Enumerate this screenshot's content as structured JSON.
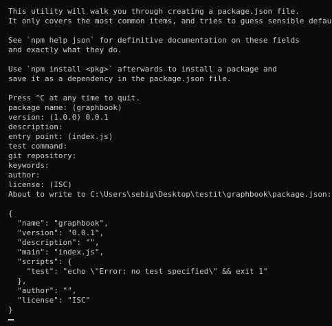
{
  "terminal": {
    "lines": [
      "This utility will walk you through creating a package.json file.",
      "It only covers the most common items, and tries to guess sensible defaults.",
      "",
      "See `npm help json` for definitive documentation on these fields",
      "and exactly what they do.",
      "",
      "Use `npm install <pkg>` afterwards to install a package and",
      "save it as a dependency in the package.json file.",
      "",
      "Press ^C at any time to quit.",
      "package name: (graphbook)",
      "version: (1.0.0) 0.0.1",
      "description:",
      "entry point: (index.js)",
      "test command:",
      "git repository:",
      "keywords:",
      "author:",
      "license: (ISC)",
      "About to write to C:\\Users\\sebig\\Desktop\\testit\\graphbook\\package.json:",
      "",
      "{",
      "  \"name\": \"graphbook\",",
      "  \"version\": \"0.0.1\",",
      "  \"description\": \"\",",
      "  \"main\": \"index.js\",",
      "  \"scripts\": {",
      "    \"test\": \"echo \\\"Error: no test specified\\\" && exit 1\"",
      "  },",
      "  \"author\": \"\",",
      "  \"license\": \"ISC\"",
      "}"
    ]
  }
}
